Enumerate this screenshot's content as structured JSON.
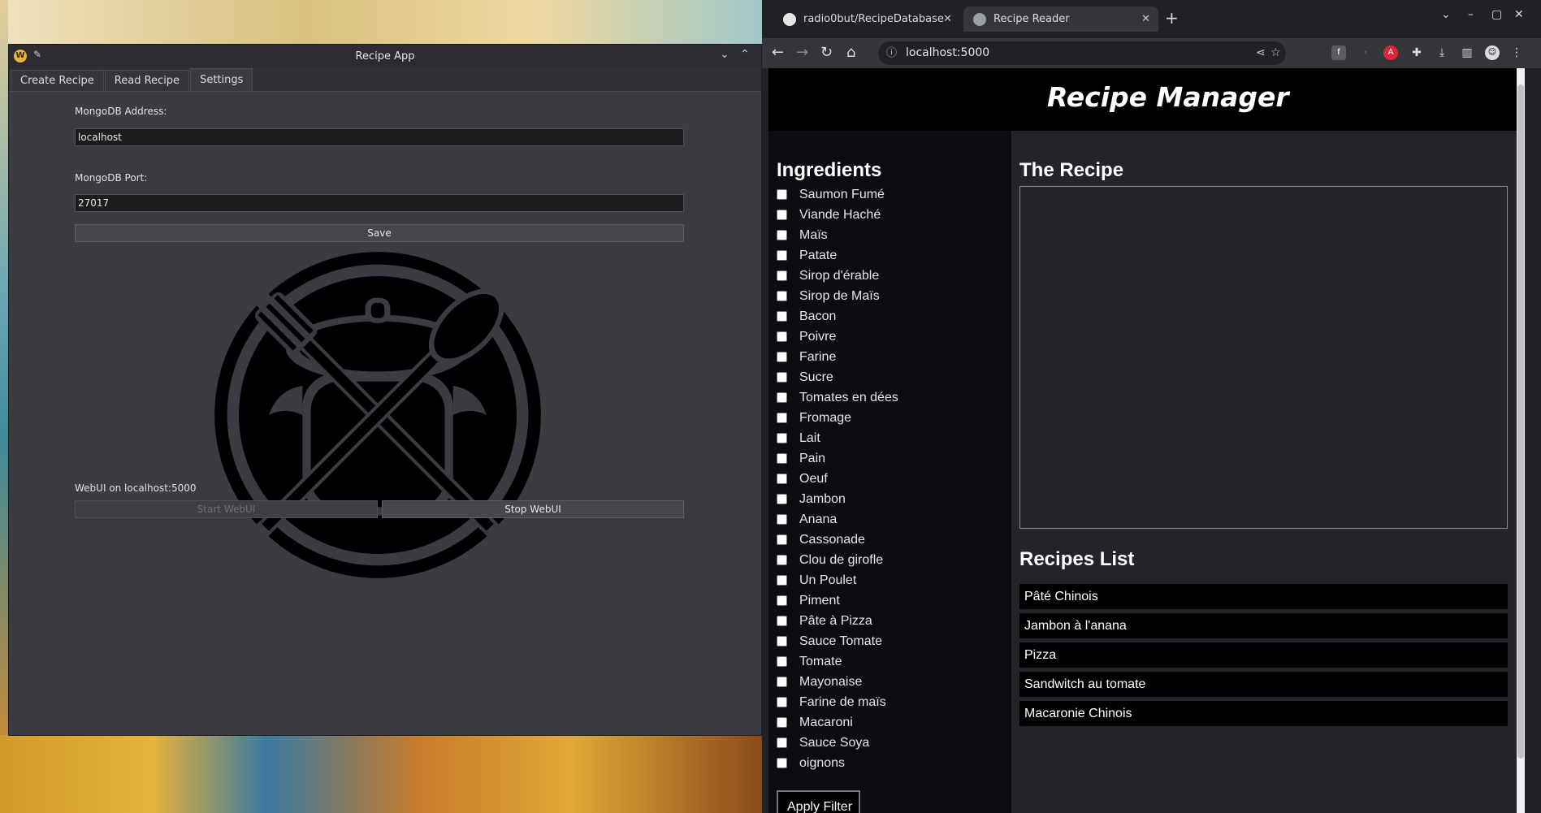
{
  "desktop_app": {
    "title": "Recipe App",
    "tabs": [
      {
        "label": "Create Recipe"
      },
      {
        "label": "Read Recipe"
      },
      {
        "label": "Settings"
      }
    ],
    "settings": {
      "address_label": "MongoDB Address:",
      "address_value": "localhost",
      "port_label": "MongoDB Port:",
      "port_value": "27017",
      "save_label": "Save",
      "webui_status": "WebUI on localhost:5000",
      "start_label": "Start WebUI",
      "stop_label": "Stop WebUI"
    }
  },
  "browser": {
    "tabs": [
      {
        "label": "radio0but/RecipeDatabase"
      },
      {
        "label": "Recipe Reader"
      }
    ],
    "url": "localhost:5000"
  },
  "page": {
    "title": "Recipe Manager",
    "ingredients_heading": "Ingredients",
    "ingredients": [
      "Saumon Fumé",
      "Viande Haché",
      "Maïs",
      "Patate",
      "Sirop d'érable",
      "Sirop de Maïs",
      "Bacon",
      "Poivre",
      "Farine",
      "Sucre",
      "Tomates en dées",
      "Fromage",
      "Lait",
      "Pain",
      "Oeuf",
      "Jambon",
      "Anana",
      "Cassonade",
      "Clou de girofle",
      "Un Poulet",
      "Piment",
      "Pâte à Pizza",
      "Sauce Tomate",
      "Tomate",
      "Mayonaise",
      "Farine de maïs",
      "Macaroni",
      "Sauce Soya",
      "oignons"
    ],
    "apply_label": "Apply Filter",
    "recipe_heading": "The Recipe",
    "list_heading": "Recipes List",
    "recipes": [
      "Pâté Chinois",
      "Jambon à l'anana",
      "Pizza",
      "Sandwitch au tomate",
      "Macaronie Chinois"
    ]
  }
}
